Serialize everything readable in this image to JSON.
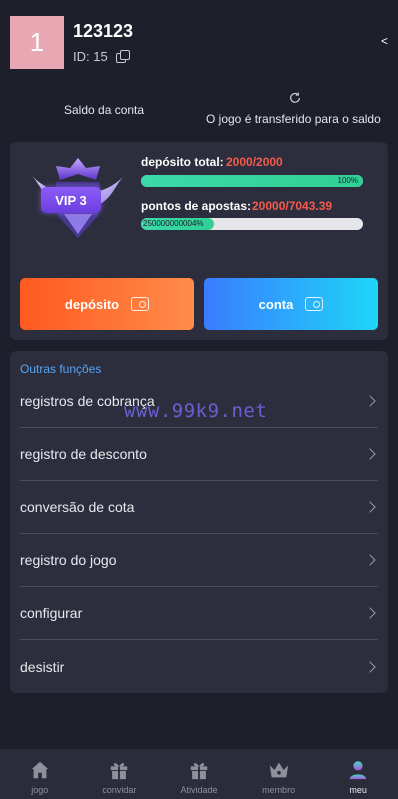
{
  "user": {
    "avatar_text": "1",
    "name": "123123",
    "id_label": "ID: 15"
  },
  "header": {
    "back_symbol": "<",
    "balance_label": "Saldo da conta",
    "transfer_label": "O jogo é transferido para o saldo"
  },
  "vip": {
    "level": "VIP 3",
    "deposit_label": "depósito total:",
    "deposit_value": "2000/2000",
    "deposit_percent_text": "100%",
    "deposit_progress": 1.0,
    "bets_label": "pontos de apostas:",
    "bets_value": "20000/7043.39",
    "bets_percent_text": "250000000004%",
    "bets_progress": 0.33
  },
  "buttons": {
    "deposit": "depósito",
    "account": "conta"
  },
  "functions": {
    "title": "Outras funções",
    "items": [
      {
        "label": "registros de cobrança"
      },
      {
        "label": "registro de desconto"
      },
      {
        "label": "conversão de cota"
      },
      {
        "label": "registro do jogo"
      },
      {
        "label": "configurar"
      },
      {
        "label": "desistir"
      }
    ]
  },
  "watermark": "www.99k9.net",
  "nav": {
    "items": [
      {
        "label": "jogo",
        "icon": "home-icon"
      },
      {
        "label": "convidar",
        "icon": "gift-icon"
      },
      {
        "label": "Atividade",
        "icon": "gift-box-icon"
      },
      {
        "label": "membro",
        "icon": "crown-icon"
      },
      {
        "label": "meu",
        "icon": "user-icon"
      }
    ]
  },
  "colors": {
    "background": "#1d1f2b",
    "card": "#2c2e3d",
    "accent_red": "#f55a4e",
    "accent_blue": "#56a5f5",
    "progress_green": "#3cd9a8"
  }
}
